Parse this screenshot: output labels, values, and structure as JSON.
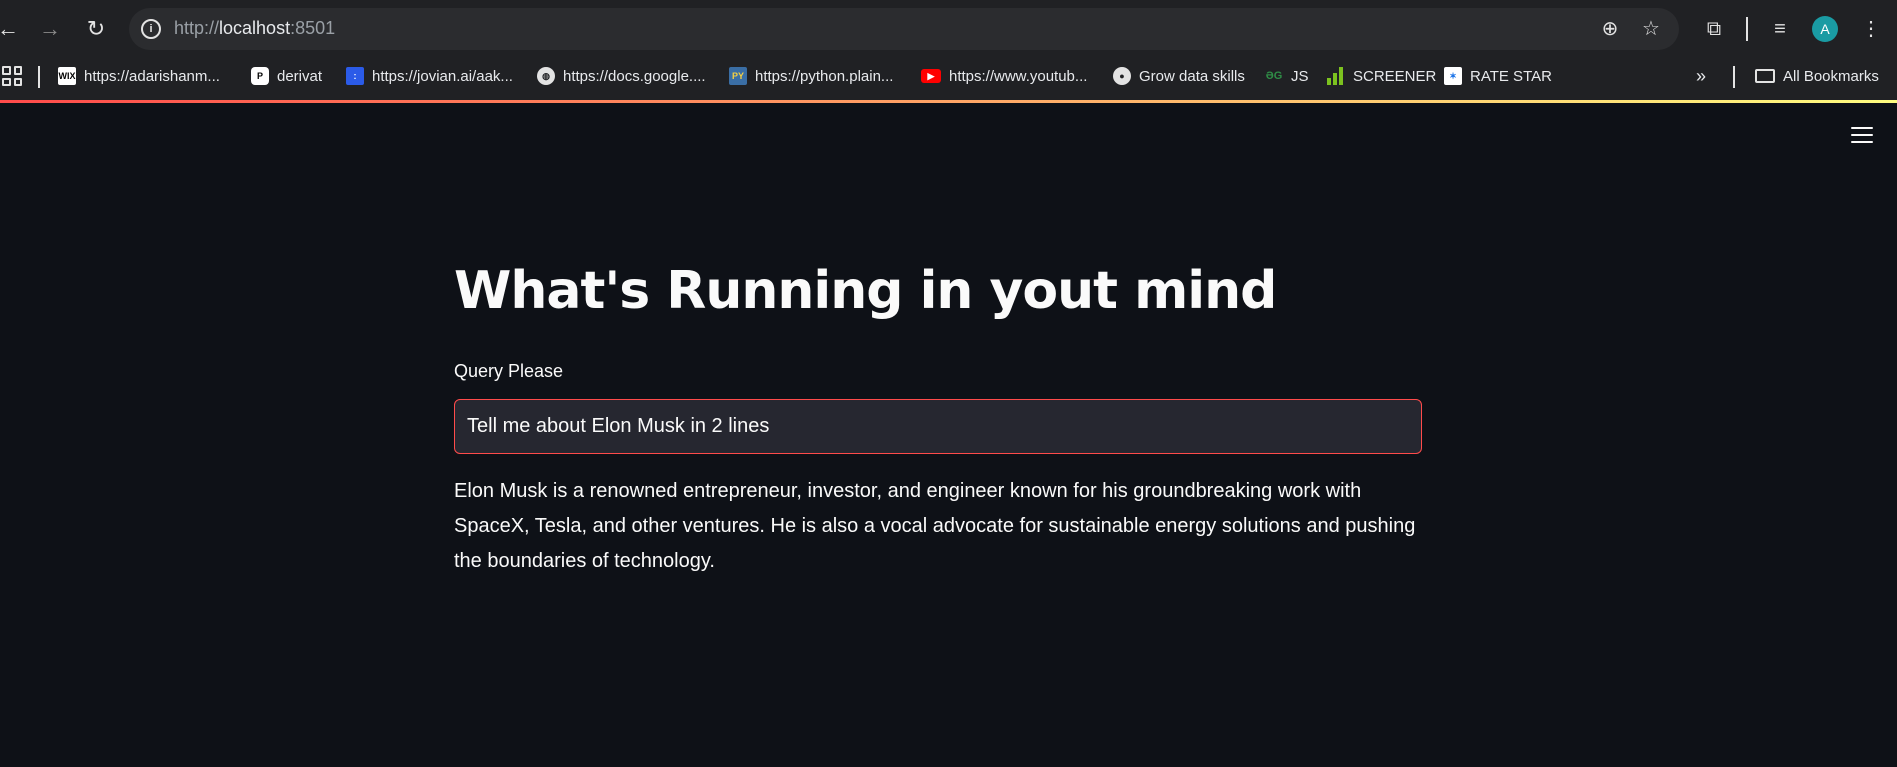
{
  "browser": {
    "url_scheme": "http://",
    "url_host": "localhost",
    "url_port": ":8501",
    "avatar_letter": "A"
  },
  "bookmarks": [
    {
      "label": "https://adarishanm...",
      "icon": "wix-icon"
    },
    {
      "label": "derivat",
      "icon": "derivat-icon"
    },
    {
      "label": "https://jovian.ai/aak...",
      "icon": "jovian-icon"
    },
    {
      "label": "https://docs.google....",
      "icon": "globe-icon"
    },
    {
      "label": "https://python.plain...",
      "icon": "python-icon"
    },
    {
      "label": "https://www.youtub...",
      "icon": "youtube-icon"
    },
    {
      "label": "Grow data skills",
      "icon": "github-icon"
    },
    {
      "label": "JS",
      "icon": "gfg-icon"
    },
    {
      "label": "SCREENER",
      "icon": "bar-chart-icon"
    },
    {
      "label": "RATE STAR",
      "icon": "ratestar-icon"
    }
  ],
  "all_bookmarks_label": "All Bookmarks",
  "app": {
    "title": "What's Running in yout mind",
    "query_label": "Query Please",
    "query_value": "Tell me about Elon Musk in 2 lines",
    "answer": "Elon Musk is a renowned entrepreneur, investor, and engineer known for his groundbreaking work with SpaceX, Tesla, and other ventures. He is also a vocal advocate for sustainable energy solutions and pushing the boundaries of technology."
  },
  "colors": {
    "background": "#0e1117",
    "accent": "#ff4b4b",
    "input_bg": "#262730"
  }
}
